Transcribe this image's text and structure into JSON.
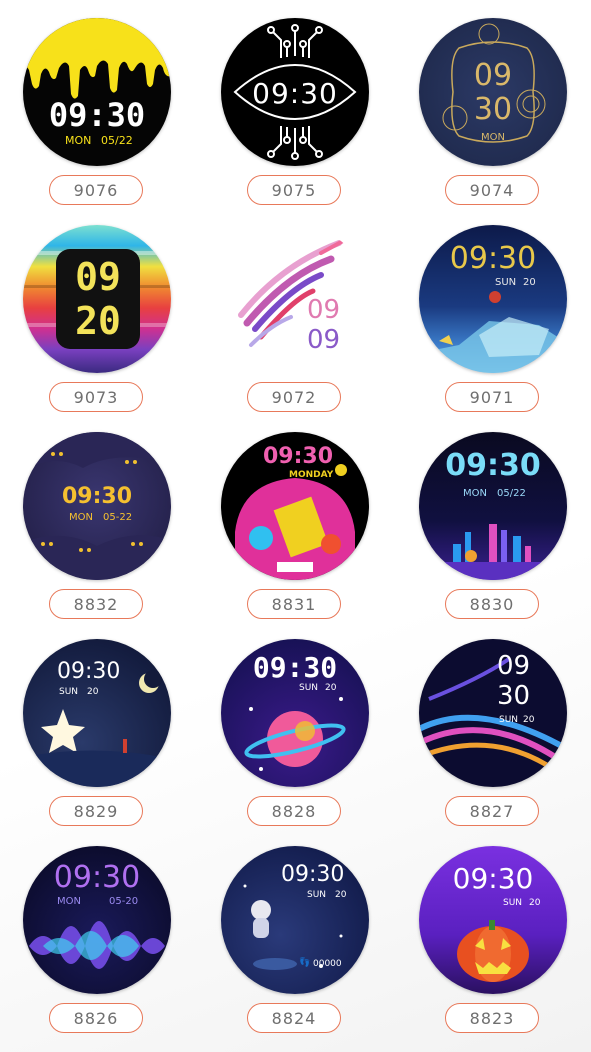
{
  "faces": [
    {
      "id": "9076",
      "time": "09:30",
      "day": "MON",
      "date": "05/22"
    },
    {
      "id": "9075",
      "time": "09:30"
    },
    {
      "id": "9074",
      "hour": "09",
      "minute": "30",
      "day": "MON"
    },
    {
      "id": "9073",
      "hour": "09",
      "minute": "20"
    },
    {
      "id": "9072",
      "hour": "09",
      "minute": "09"
    },
    {
      "id": "9071",
      "time": "09:30",
      "day": "SUN",
      "date": "20"
    },
    {
      "id": "8832",
      "time": "09:30",
      "day": "MON",
      "date": "05-22"
    },
    {
      "id": "8831",
      "time": "09:30",
      "day": "MONDAY"
    },
    {
      "id": "8830",
      "time": "09:30",
      "day": "MON",
      "date": "05/22"
    },
    {
      "id": "8829",
      "time": "09:30",
      "day": "SUN",
      "date": "20"
    },
    {
      "id": "8828",
      "time": "09:30",
      "day": "SUN",
      "date": "20"
    },
    {
      "id": "8827",
      "hour": "09",
      "minute": "30",
      "day": "SUN",
      "date": "20"
    },
    {
      "id": "8826",
      "time": "09:30",
      "day": "MON",
      "date": "05-20"
    },
    {
      "id": "8824",
      "time": "09:30",
      "day": "SUN",
      "date": "20",
      "steps": "00000"
    },
    {
      "id": "8823",
      "time": "09:30",
      "day": "SUN",
      "date": "20"
    }
  ],
  "colors": {
    "accent_border": "#e8795a",
    "label_text": "#6f6f6f"
  }
}
